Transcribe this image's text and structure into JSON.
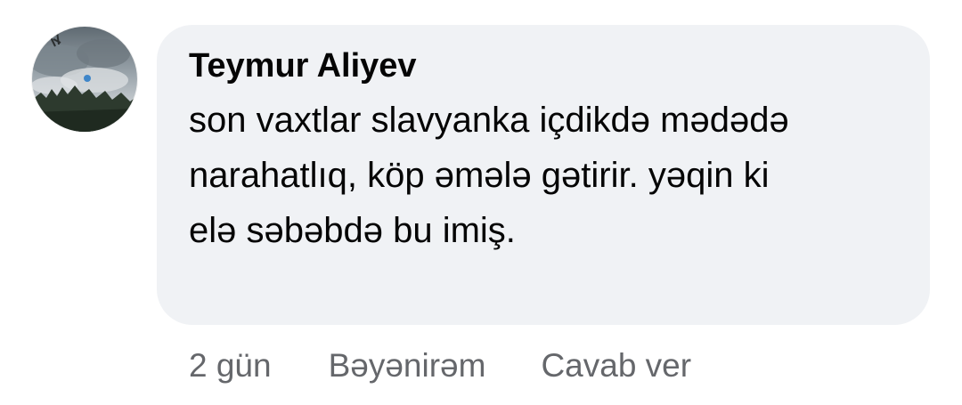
{
  "comment": {
    "author": "Teymur Aliyev",
    "text": "son vaxtlar slavyanka içdikdə mədədə narahatlıq, köp əmələ gətirir. yəqin ki elə səbəbdə bu imiş.",
    "time": "2 gün",
    "like_label": "Bəyənirəm",
    "reply_label": "Cavab ver"
  },
  "colors": {
    "bubble_bg": "#f0f2f5",
    "text": "#050505",
    "secondary_text": "#65676b"
  }
}
